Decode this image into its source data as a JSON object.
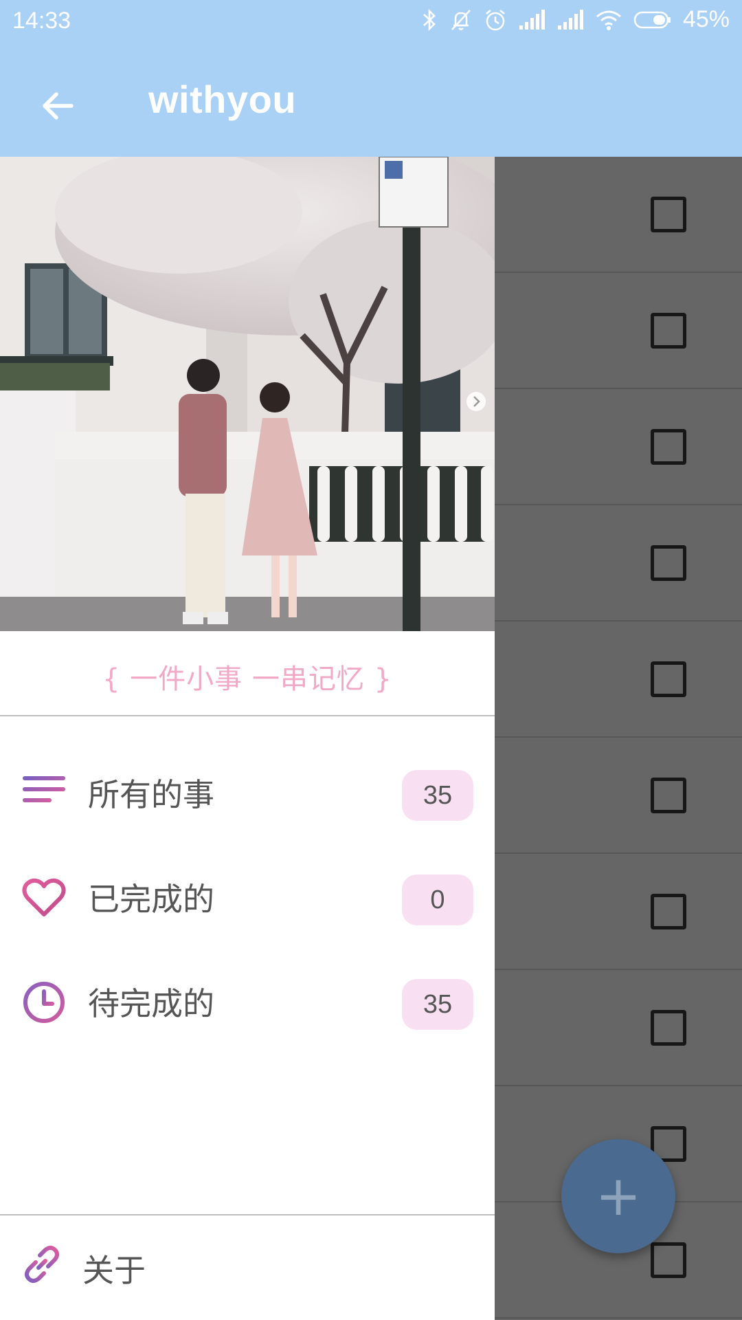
{
  "status_bar": {
    "time": "14:33",
    "battery_percent": "45%",
    "icons": [
      "bluetooth-icon",
      "mute-icon",
      "alarm-icon",
      "signal-icon",
      "signal-icon",
      "wifi-icon",
      "battery-icon"
    ]
  },
  "app_bar": {
    "title": "withyou",
    "back_icon": "arrow-back-icon",
    "background_color": "#a9d0f5"
  },
  "drawer": {
    "header_image": "photo-couple-under-blossom-tree",
    "slogan": "{ 一件小事 一串记忆 }",
    "slogan_color": "#f2a9c6",
    "menu_items": [
      {
        "label": "所有的事",
        "count": "35",
        "icon": "list-lines-icon"
      },
      {
        "label": "已完成的",
        "count": "0",
        "icon": "heart-icon"
      },
      {
        "label": "待完成的",
        "count": "35",
        "icon": "clock-icon"
      }
    ],
    "about": {
      "label": "关于",
      "icon": "link-icon"
    },
    "badge_color": "#f8e0f2",
    "icon_gradient": [
      "#e15c9c",
      "#7a5fbf"
    ]
  },
  "list": {
    "checkbox_count": 10
  },
  "fab": {
    "icon": "plus-icon",
    "symbol": "+"
  }
}
